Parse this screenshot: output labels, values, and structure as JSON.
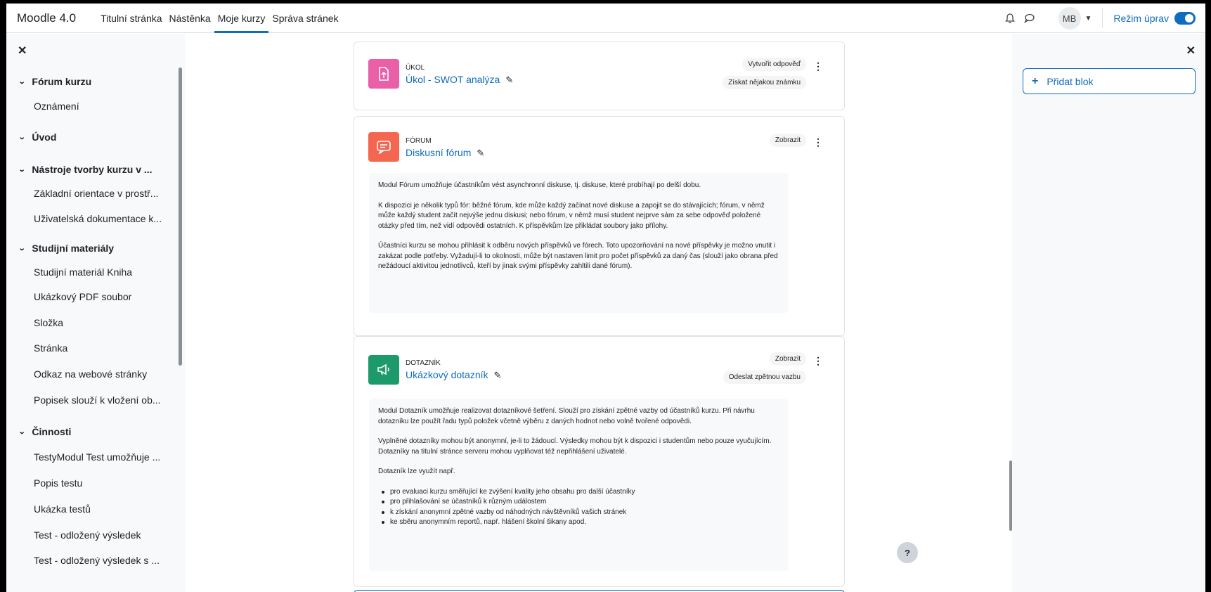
{
  "navbar": {
    "brand": "Moodle 4.0",
    "links": [
      "Titulní stránka",
      "Nástěnka",
      "Moje kurzy",
      "Správa stránek"
    ],
    "avatar": "MB",
    "edit_mode_label": "Režim úprav",
    "edit_mode_on": true
  },
  "left_drawer": {
    "close_icon": "✕",
    "sections": [
      {
        "label": "Fórum kurzu",
        "items": [
          "Oznámení"
        ]
      },
      {
        "label": "Úvod",
        "items": []
      },
      {
        "label": "Nástroje tvorby kurzu v ...",
        "items": [
          "Základní orientace v prostř...",
          "Uživatelská dokumentace k..."
        ]
      },
      {
        "label": "Studijní materiály",
        "items": [
          "Studijní materiál Kniha",
          "Ukázkový PDF soubor",
          "Složka",
          "Stránka",
          "Odkaz na webové stránky",
          "Popisek slouží k vložení ob..."
        ]
      },
      {
        "label": "Činnosti",
        "items": [
          "TestyModul Test umožňuje ...",
          "Popis testu",
          "Ukázka testů",
          "Test - odložený výsledek",
          "Test - odložený výsledek s ..."
        ]
      }
    ]
  },
  "activities": [
    {
      "type": "ÚKOL",
      "title": "Úkol - SWOT analýza",
      "color": "#e95fa8",
      "icon": "upload-icon",
      "badges": [
        "Vytvořit odpověď",
        "Získat nějakou známku"
      ]
    },
    {
      "type": "FÓRUM",
      "title": "Diskusní fórum",
      "color": "#f4664f",
      "icon": "forum-icon",
      "badges": [
        "Zobrazit"
      ],
      "description": [
        "Modul Fórum umožňuje účastníkům vést asynchronní diskuse, tj. diskuse, které probíhají po delší dobu.",
        "K dispozici je několik typů fór: běžné fórum, kde může každý začínat nové diskuse a zapojit se do stávajících; fórum, v němž může každý student začít nejvýše jednu diskusi; nebo fórum, v němž musí student nejprve sám za sebe odpověď položené otázky před tím, než vidí odpovědi ostatních. K příspěvkům lze přikládat soubory jako přílohy.",
        "Účastníci kurzu se mohou přihlásit k odběru nových příspěvků ve fórech. Toto upozorňování na nové příspěvky je možno vnutit i zakázat podle potřeby. Vyžadují-li to okolnosti, může být nastaven limit pro počet příspěvků za daný čas (slouží jako obrana před nežádoucí aktivitou jednotlivců, kteří by jinak svými příspěvky zahltili dané fórum)."
      ]
    },
    {
      "type": "DOTAZNÍK",
      "title": "Ukázkový dotazník",
      "color": "#1d9a6c",
      "icon": "megaphone-icon",
      "badges": [
        "Zobrazit",
        "Odeslat zpětnou vazbu"
      ],
      "description": [
        "Modul Dotazník umožňuje realizovat dotazníkové šetření. Slouží pro získání zpětné vazby od účastníků kurzu. Při návrhu dotazníku lze použít řadu typů položek včetně výběru z daných hodnot nebo volně tvořené odpovědi.",
        "Vyplněné dotazníky mohou být anonymní, je-li to žádoucí. Výsledky mohou být k dispozici i studentům nebo pouze vyučujícím. Dotazníky na titulní stránce serveru mohou vyplňovat též nepřihlášení uživatelé.",
        "Dotazník lze využít např."
      ],
      "bullets": [
        "pro evaluaci kurzu směřující ke zvýšení kvality jeho obsahu pro další účastníky",
        "pro přihlašování se účastníků k různým událostem",
        "k získání anonymní zpětné vazby od náhodných návštěvníků vašich stránek",
        "ke sběru anonymním reportů, např. hlášení školní šikany apod."
      ]
    }
  ],
  "right_drawer": {
    "add_block_label": "Přidat blok"
  },
  "help_label": "?"
}
